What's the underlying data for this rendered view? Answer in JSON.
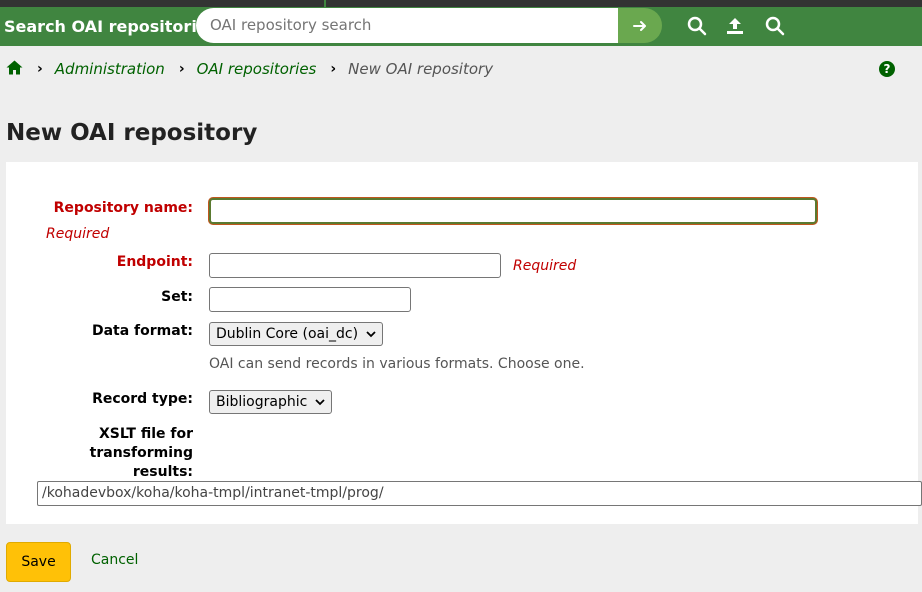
{
  "header": {
    "search_label": "Search OAI repositories",
    "search_placeholder": "OAI repository search",
    "icons": [
      "arrow-right-icon",
      "search-icon",
      "upload-icon",
      "search-icon"
    ]
  },
  "breadcrumb": {
    "items": [
      "Administration",
      "OAI repositories"
    ],
    "current": "New OAI repository"
  },
  "page": {
    "title": "New OAI repository"
  },
  "form": {
    "repository_name": {
      "label": "Repository name:",
      "value": "",
      "required_text": "Required"
    },
    "endpoint": {
      "label": "Endpoint:",
      "value": "",
      "required_text": "Required"
    },
    "set": {
      "label": "Set:",
      "value": ""
    },
    "data_format": {
      "label": "Data format:",
      "selected": "Dublin Core (oai_dc)",
      "hint": "OAI can send records in various formats. Choose one."
    },
    "record_type": {
      "label": "Record type:",
      "selected": "Bibliographic"
    },
    "xslt": {
      "label_line1": "XSLT file for",
      "label_line2": "transforming",
      "label_line3": "results:",
      "value": "/kohadevbox/koha/koha-tmpl/intranet-tmpl/prog/"
    }
  },
  "actions": {
    "save_label": "Save",
    "cancel_label": "Cancel"
  },
  "colors": {
    "header": "#408540",
    "link": "#006100",
    "required": "#c00000",
    "save": "#ffc107"
  }
}
